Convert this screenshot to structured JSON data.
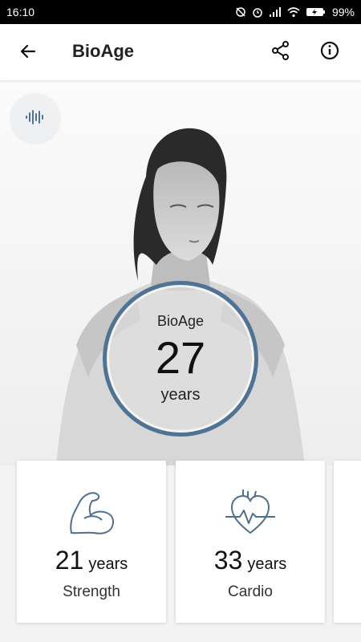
{
  "status": {
    "time": "16:10",
    "battery": "99%"
  },
  "header": {
    "title": "BioAge"
  },
  "bio": {
    "label": "BioAge",
    "value": "27",
    "unit": "years"
  },
  "cards": [
    {
      "value": "21",
      "unit": "years",
      "label": "Strength",
      "icon": "flexed-arm-icon"
    },
    {
      "value": "33",
      "unit": "years",
      "label": "Cardio",
      "icon": "heart-pulse-icon"
    }
  ],
  "colors": {
    "accent": "#4e7394",
    "icon": "#4f6f8c"
  }
}
